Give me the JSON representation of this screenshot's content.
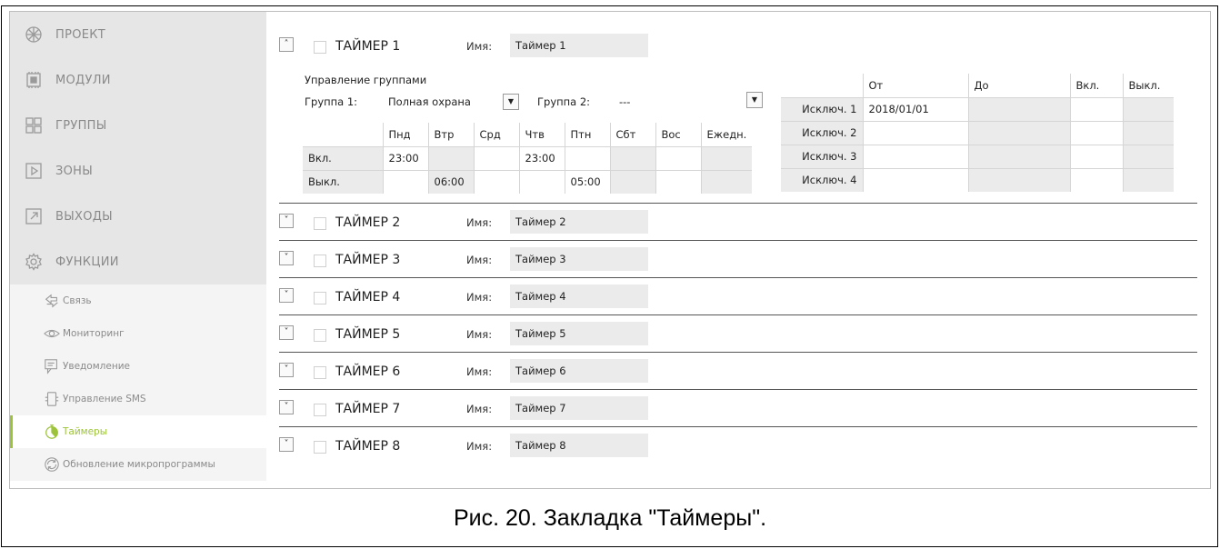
{
  "sidebar": {
    "main_items": [
      {
        "label": "ПРОЕКТ",
        "icon": "project-icon"
      },
      {
        "label": "МОДУЛИ",
        "icon": "modules-icon"
      },
      {
        "label": "ГРУППЫ",
        "icon": "groups-icon"
      },
      {
        "label": "ЗОНЫ",
        "icon": "zones-icon"
      },
      {
        "label": "ВЫХОДЫ",
        "icon": "outputs-icon"
      },
      {
        "label": "ФУНКЦИИ",
        "icon": "gear-icon"
      }
    ],
    "sub_items": [
      {
        "label": "Связь",
        "icon": "communication-icon"
      },
      {
        "label": "Мониторинг",
        "icon": "eye-icon"
      },
      {
        "label": "Уведомление",
        "icon": "notification-icon"
      },
      {
        "label": "Управление SMS",
        "icon": "sms-icon"
      },
      {
        "label": "Таймеры",
        "icon": "stopwatch-icon",
        "active": true
      },
      {
        "label": "Обновление микропрограммы",
        "icon": "update-icon"
      }
    ],
    "accent_color": "#9dc33b"
  },
  "timer1": {
    "title": "ТАЙМЕР 1",
    "name_label": "Имя:",
    "name_value": "Таймер 1",
    "group_control_label": "Управление группами",
    "group1_label": "Группа 1:",
    "group1_value": "Полная охрана",
    "group2_label": "Группа 2:",
    "group2_value": "---",
    "schedule": {
      "days": [
        "Пнд",
        "Втр",
        "Срд",
        "Чтв",
        "Птн",
        "Сбт",
        "Вос",
        "Ежедн."
      ],
      "rows": [
        {
          "label": "Вкл.",
          "values": [
            "23:00",
            "",
            "",
            "23:00",
            "",
            "",
            "",
            ""
          ]
        },
        {
          "label": "Выкл.",
          "values": [
            "",
            "06:00",
            "",
            "",
            "05:00",
            "",
            "",
            ""
          ]
        }
      ]
    },
    "exceptions": {
      "headers": [
        "От",
        "До",
        "Вкл.",
        "Выкл."
      ],
      "rows": [
        {
          "label": "Исключ. 1",
          "from": "2018/01/01",
          "to": "",
          "on": "",
          "off": ""
        },
        {
          "label": "Исключ. 2",
          "from": "",
          "to": "",
          "on": "",
          "off": ""
        },
        {
          "label": "Исключ. 3",
          "from": "",
          "to": "",
          "on": "",
          "off": ""
        },
        {
          "label": "Исключ. 4",
          "from": "",
          "to": "",
          "on": "",
          "off": ""
        }
      ]
    }
  },
  "collapsed_timers": [
    {
      "title": "ТАЙМЕР 2",
      "name_label": "Имя:",
      "name_value": "Таймер 2"
    },
    {
      "title": "ТАЙМЕР 3",
      "name_label": "Имя:",
      "name_value": "Таймер 3"
    },
    {
      "title": "ТАЙМЕР 4",
      "name_label": "Имя:",
      "name_value": "Таймер 4"
    },
    {
      "title": "ТАЙМЕР 5",
      "name_label": "Имя:",
      "name_value": "Таймер 5"
    },
    {
      "title": "ТАЙМЕР 6",
      "name_label": "Имя:",
      "name_value": "Таймер 6"
    },
    {
      "title": "ТАЙМЕР 7",
      "name_label": "Имя:",
      "name_value": "Таймер 7"
    },
    {
      "title": "ТАЙМЕР 8",
      "name_label": "Имя:",
      "name_value": "Таймер 8"
    }
  ],
  "caption": "Рис. 20. Закладка \"Таймеры\"."
}
